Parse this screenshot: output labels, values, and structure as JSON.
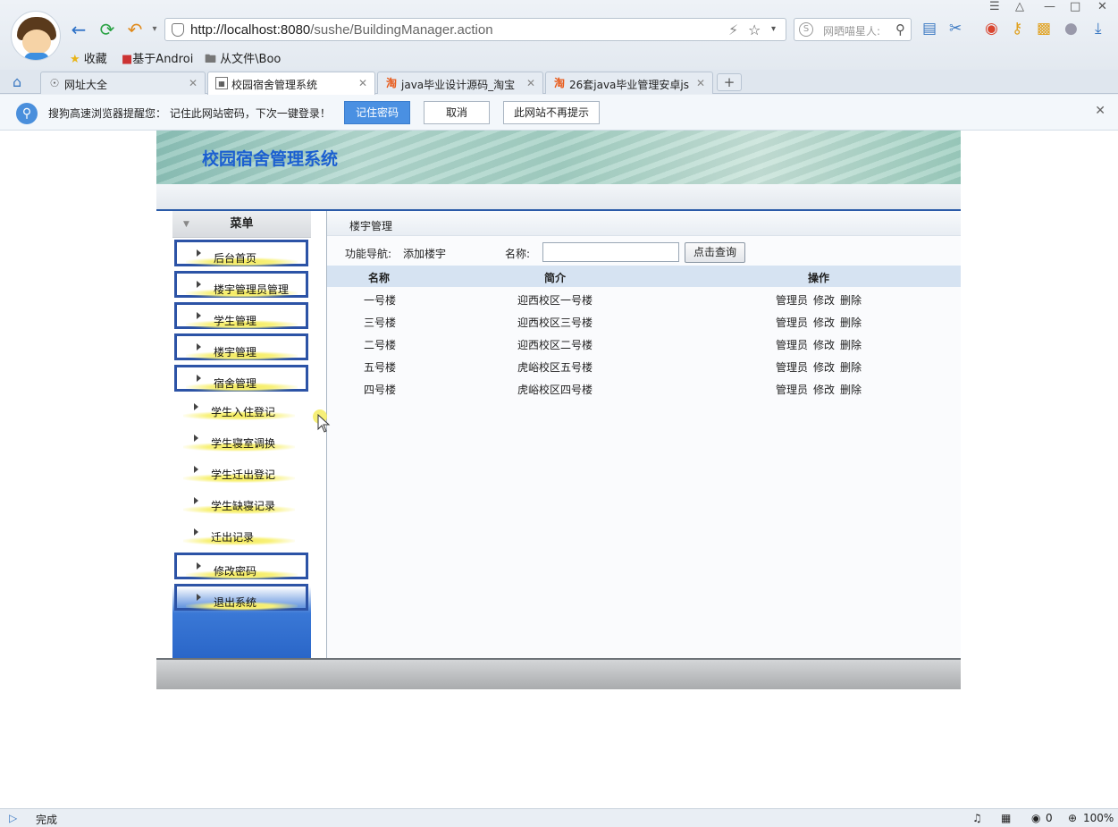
{
  "browser": {
    "url_host": "http://localhost:8080",
    "url_path": "/sushe/BuildingManager.action",
    "search_placeholder": "网晒喵星人:",
    "bookmarks": [
      {
        "label": "收藏"
      },
      {
        "label": "基于Androi"
      },
      {
        "label": "从文件\\Boo"
      }
    ],
    "tabs": [
      {
        "label": "网址大全",
        "active": false
      },
      {
        "label": "校园宿舍管理系统",
        "active": true
      },
      {
        "label": "java毕业设计源码_淘宝",
        "active": false
      },
      {
        "label": "26套java毕业管理安卓js",
        "active": false
      }
    ],
    "notification": {
      "message": "搜狗高速浏览器提醒您：  记住此网站密码，下次一键登录！",
      "remember_label": "记住密码",
      "cancel_label": "取消",
      "never_label": "此网站不再提示"
    },
    "status": {
      "text": "完成",
      "counter": "0",
      "zoom": "100%"
    }
  },
  "app": {
    "title": "校园宿舍管理系统",
    "menu_title": "菜单",
    "menu": [
      {
        "label": "后台首页"
      },
      {
        "label": "楼宇管理员管理"
      },
      {
        "label": "学生管理"
      },
      {
        "label": "楼宇管理"
      },
      {
        "label": "宿舍管理"
      },
      {
        "label": "学生入住登记"
      },
      {
        "label": "学生寝室调换"
      },
      {
        "label": "学生迁出登记"
      },
      {
        "label": "学生缺寝记录"
      },
      {
        "label": "迁出记录"
      },
      {
        "label": "修改密码"
      },
      {
        "label": "退出系统"
      }
    ],
    "main": {
      "section_title": "楼宇管理",
      "nav_label": "功能导航:",
      "add_link": "添加楼宇",
      "name_label": "名称:",
      "name_value": "",
      "query_button": "点击查询",
      "columns": [
        "名称",
        "简介",
        "操作"
      ],
      "rows": [
        {
          "name": "一号楼",
          "intro": "迎西校区一号楼"
        },
        {
          "name": "三号楼",
          "intro": "迎西校区三号楼"
        },
        {
          "name": "二号楼",
          "intro": "迎西校区二号楼"
        },
        {
          "name": "五号楼",
          "intro": "虎峪校区五号楼"
        },
        {
          "name": "四号楼",
          "intro": "虎峪校区四号楼"
        }
      ],
      "row_actions": [
        "管理员",
        "修改",
        "删除"
      ]
    }
  }
}
